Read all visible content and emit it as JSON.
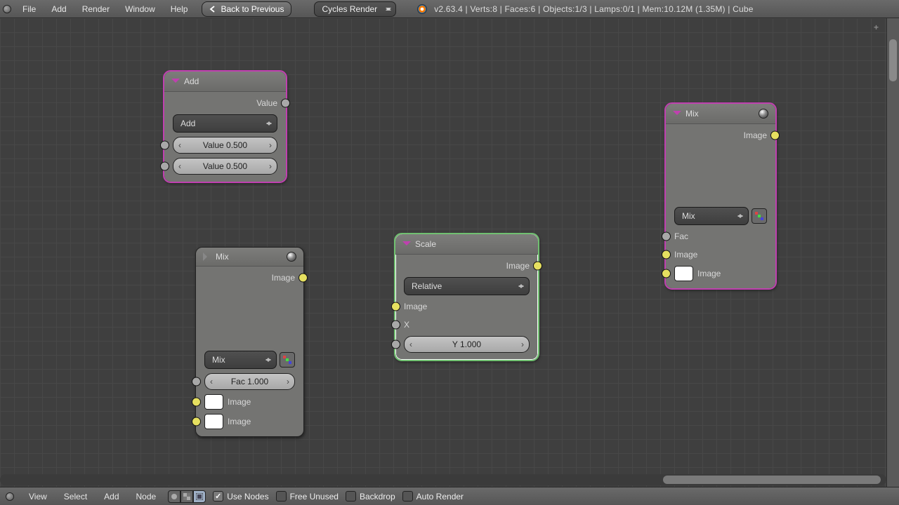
{
  "topmenu": {
    "file": "File",
    "add": "Add",
    "render": "Render",
    "window": "Window",
    "help": "Help"
  },
  "back_btn": "Back to Previous",
  "engine": "Cycles Render",
  "stats": "v2.63.4 | Verts:8 | Faces:6 | Objects:1/3 | Lamps:0/1 | Mem:10.12M (1.35M) | Cube",
  "botmenu": {
    "view": "View",
    "select": "Select",
    "add": "Add",
    "node": "Node"
  },
  "checks": {
    "use_nodes": "Use Nodes",
    "free_unused": "Free Unused",
    "backdrop": "Backdrop",
    "auto_render": "Auto Render"
  },
  "node_add": {
    "title": "Add",
    "out": "Value",
    "mode": "Add",
    "v1": "Value 0.500",
    "v2": "Value 0.500"
  },
  "node_mix1": {
    "title": "Mix",
    "out": "Image",
    "mode": "Mix",
    "fac": "Fac 1.000",
    "img1": "Image",
    "img2": "Image"
  },
  "node_scale": {
    "title": "Scale",
    "out": "Image",
    "mode": "Relative",
    "img": "Image",
    "x": "X",
    "y": "Y 1.000"
  },
  "node_mix2": {
    "title": "Mix",
    "out": "Image",
    "mode": "Mix",
    "fac": "Fac",
    "img1": "Image",
    "img2": "Image"
  }
}
